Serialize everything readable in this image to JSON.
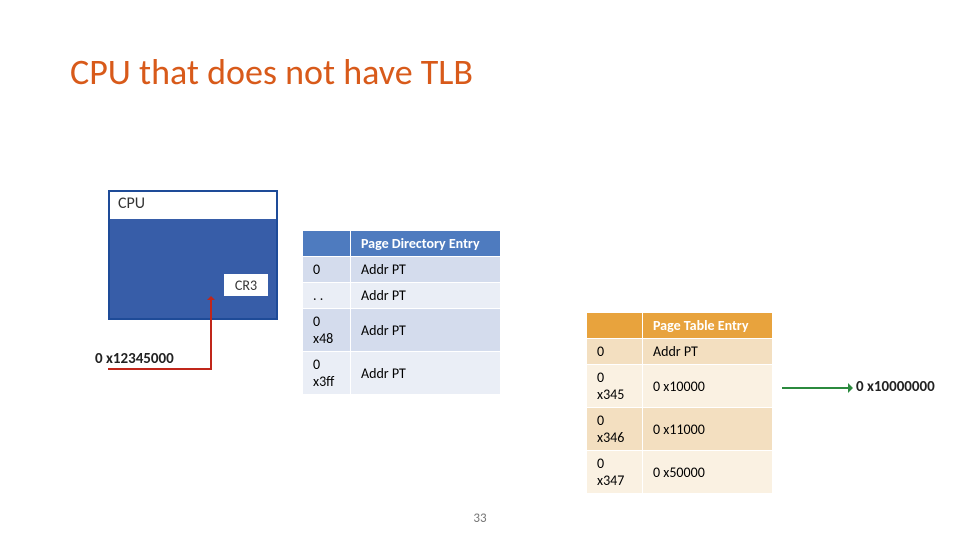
{
  "title": "CPU that does not have TLB",
  "cpu": {
    "label": "CPU",
    "reg": "CR3",
    "reg_value": "0 x12345000"
  },
  "pde": {
    "header": "Page Directory Entry",
    "rows": [
      {
        "idx": "0",
        "val": "Addr PT"
      },
      {
        "idx": ". .",
        "val": "Addr PT"
      },
      {
        "idx": "0 x48",
        "val": "Addr PT"
      },
      {
        "idx": "0 x3ff",
        "val": "Addr PT"
      }
    ]
  },
  "pte": {
    "header": "Page Table Entry",
    "rows": [
      {
        "idx": "0",
        "val": "Addr PT"
      },
      {
        "idx": "0 x345",
        "val": "0 x10000"
      },
      {
        "idx": "0 x346",
        "val": "0 x11000"
      },
      {
        "idx": "0 x347",
        "val": "0 x50000"
      }
    ]
  },
  "result": "0 x10000000",
  "slide_number": "33"
}
